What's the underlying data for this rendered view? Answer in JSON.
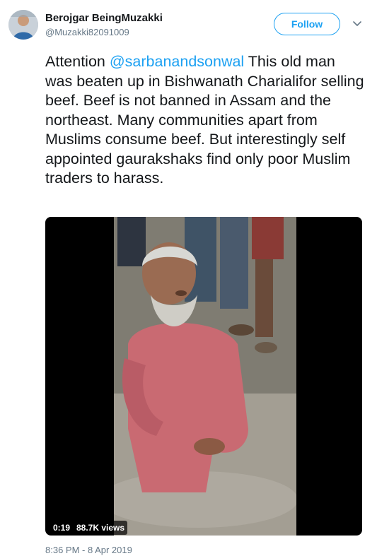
{
  "author": {
    "name": "Berojgar BeingMuzakki",
    "handle": "@Muzakki82091009"
  },
  "follow_label": "Follow",
  "tweet": {
    "prefix": "Attention ",
    "mention": "@sarbanandsonwal",
    "body": " This old man was beaten up in Bishwanath Charialifor selling beef. Beef is not banned in Assam and the northeast. Many communities apart from Muslims consume beef. But interestingly self appointed gaurakshaks find only poor Muslim traders to harass."
  },
  "video": {
    "duration": "0:19",
    "views": "88.7K views"
  },
  "timestamp": "8:36 PM - 8 Apr 2019",
  "colors": {
    "accent": "#1da1f2",
    "secondary_text": "#657786",
    "primary_text": "#14171a"
  },
  "icons": [
    "avatar",
    "chevron-down-icon"
  ]
}
